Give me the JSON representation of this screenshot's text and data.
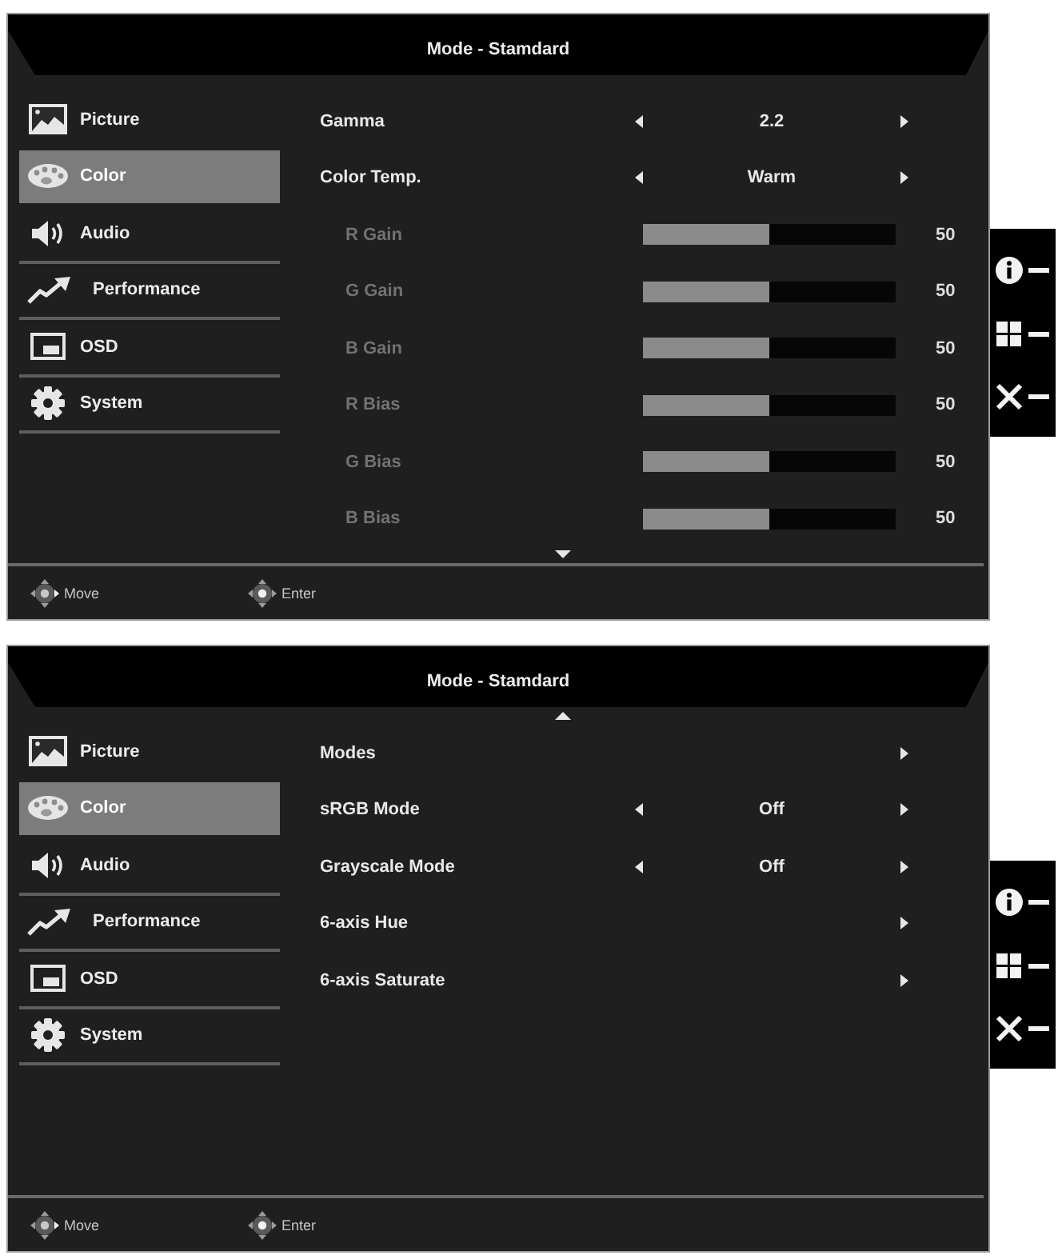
{
  "panels": [
    {
      "title": "Mode - Stamdard",
      "more_above": false,
      "more_below": true,
      "sidebar": [
        {
          "label": "Picture",
          "selected": false
        },
        {
          "label": "Color",
          "selected": true
        },
        {
          "label": "Audio",
          "selected": false
        },
        {
          "label": "Performance",
          "selected": false
        },
        {
          "label": "OSD",
          "selected": false
        },
        {
          "label": "System",
          "selected": false
        }
      ],
      "settings": [
        {
          "kind": "choice",
          "label": "Gamma",
          "value": "2.2"
        },
        {
          "kind": "choice",
          "label": "Color Temp.",
          "value": "Warm",
          "children": [
            {
              "kind": "slider",
              "label": "R Gain",
              "level": 0.5,
              "reading": "50"
            },
            {
              "kind": "slider",
              "label": "G Gain",
              "level": 0.5,
              "reading": "50"
            },
            {
              "kind": "slider",
              "label": "B Gain",
              "level": 0.5,
              "reading": "50"
            },
            {
              "kind": "slider",
              "label": "R Bias",
              "level": 0.5,
              "reading": "50"
            },
            {
              "kind": "slider",
              "label": "G Bias",
              "level": 0.5,
              "reading": "50"
            },
            {
              "kind": "slider",
              "label": "B Bias",
              "level": 0.5,
              "reading": "50"
            }
          ]
        }
      ],
      "footer": [
        {
          "label": "Move"
        },
        {
          "label": "Enter"
        }
      ]
    },
    {
      "title": "Mode - Stamdard",
      "more_above": true,
      "more_below": false,
      "sidebar": [
        {
          "label": "Picture",
          "selected": false
        },
        {
          "label": "Color",
          "selected": true
        },
        {
          "label": "Audio",
          "selected": false
        },
        {
          "label": "Performance",
          "selected": false
        },
        {
          "label": "OSD",
          "selected": false
        },
        {
          "label": "System",
          "selected": false
        }
      ],
      "settings": [
        {
          "kind": "submenu",
          "label": "Modes"
        },
        {
          "kind": "choice",
          "label": "sRGB Mode",
          "value": "Off"
        },
        {
          "kind": "choice",
          "label": "Grayscale Mode",
          "value": "Off"
        },
        {
          "kind": "submenu",
          "label": "6-axis Hue"
        },
        {
          "kind": "submenu",
          "label": "6-axis Saturate"
        }
      ],
      "footer": [
        {
          "label": "Move"
        },
        {
          "label": "Enter"
        }
      ]
    }
  ]
}
